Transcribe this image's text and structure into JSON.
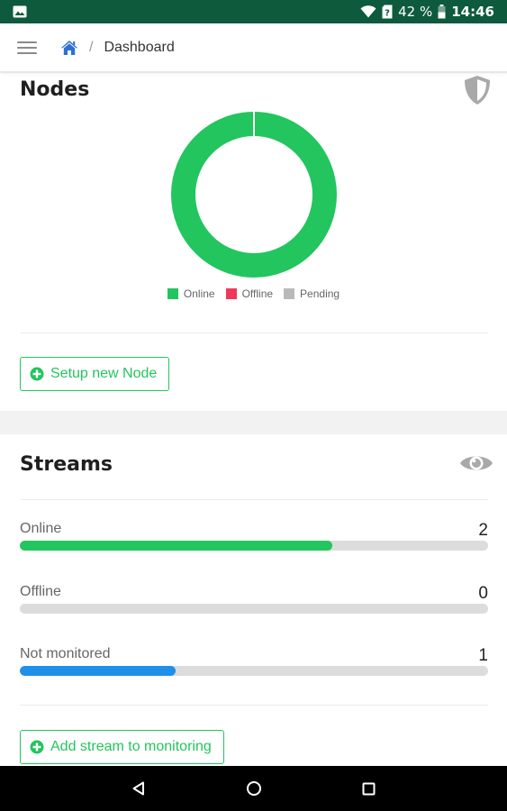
{
  "status_bar": {
    "battery_percent": "42 %",
    "time": "14:46"
  },
  "header": {
    "breadcrumb": {
      "separator": "/",
      "current": "Dashboard"
    }
  },
  "nodes_card": {
    "title": "Nodes",
    "legend": [
      {
        "label": "Online",
        "color": "#22c55e"
      },
      {
        "label": "Offline",
        "color": "#f0385a"
      },
      {
        "label": "Pending",
        "color": "#b9b9b9"
      }
    ],
    "setup_button_label": "Setup new Node"
  },
  "chart_data": {
    "type": "pie",
    "donut": true,
    "categories": [
      "Online",
      "Offline",
      "Pending"
    ],
    "values": [
      1,
      0,
      0
    ],
    "colors": [
      "#22c55e",
      "#f0385a",
      "#b9b9b9"
    ],
    "legend": "bottom"
  },
  "streams_card": {
    "title": "Streams",
    "rows": [
      {
        "label": "Online",
        "count": "2",
        "fraction": 0.667,
        "color": "#22c55e"
      },
      {
        "label": "Offline",
        "count": "0",
        "fraction": 0,
        "color": "#22c55e"
      },
      {
        "label": "Not monitored",
        "count": "1",
        "fraction": 0.333,
        "color": "#1e90ea"
      }
    ],
    "add_button_label": "Add stream to monitoring"
  },
  "icons": {
    "status_left": "image-icon",
    "status_right": [
      "wifi-icon",
      "battery-icon"
    ],
    "header": [
      "menu-icon",
      "home-icon"
    ],
    "nodes": "shield-icon",
    "streams": "eye-icon",
    "buttons": "plus-circle-icon",
    "navigation": [
      "back-icon",
      "home-circle-icon",
      "recents-icon"
    ]
  }
}
